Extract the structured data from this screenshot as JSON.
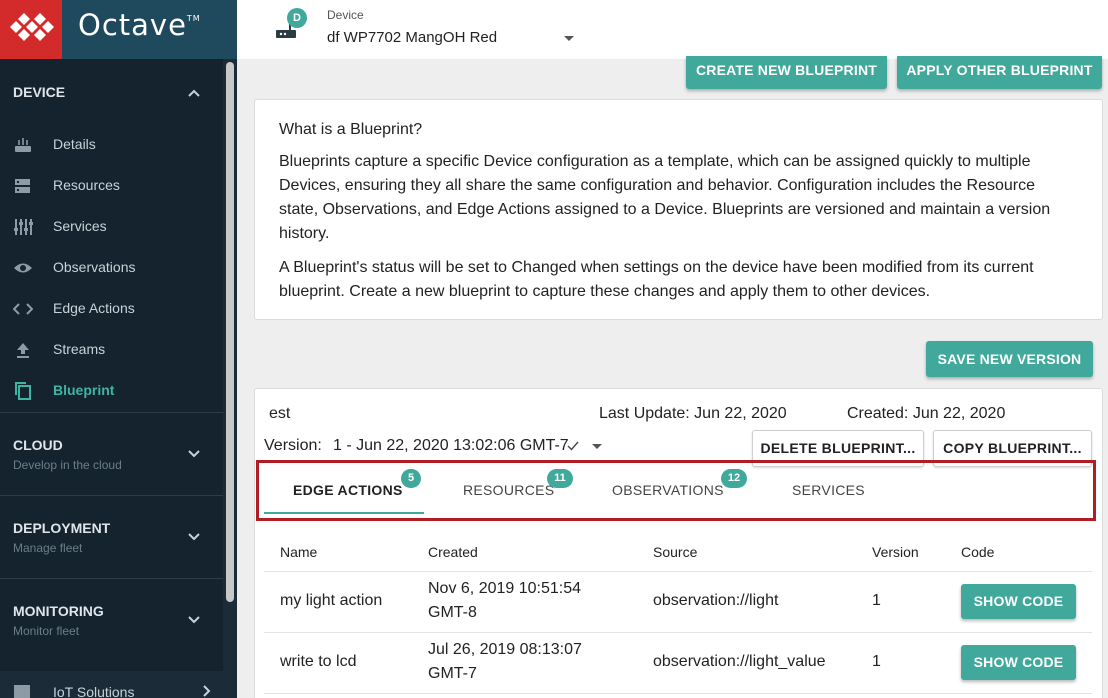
{
  "app": {
    "logo_text": "Octave",
    "logo_tm": "TM"
  },
  "sidebar": {
    "device_section": {
      "title": "DEVICE"
    },
    "items": [
      {
        "label": "Details",
        "icon": "router-icon"
      },
      {
        "label": "Resources",
        "icon": "storage-icon"
      },
      {
        "label": "Services",
        "icon": "tune-icon"
      },
      {
        "label": "Observations",
        "icon": "eye-icon"
      },
      {
        "label": "Edge Actions",
        "icon": "code-icon"
      },
      {
        "label": "Streams",
        "icon": "upload-icon"
      },
      {
        "label": "Blueprint",
        "icon": "copy-icon",
        "active": true
      }
    ],
    "cloud": {
      "title": "CLOUD",
      "subtitle": "Develop in the cloud"
    },
    "deployment": {
      "title": "DEPLOYMENT",
      "subtitle": "Manage fleet"
    },
    "monitoring": {
      "title": "MONITORING",
      "subtitle": "Monitor fleet"
    },
    "iot": {
      "label": "IoT Solutions"
    }
  },
  "header": {
    "device_label": "Device",
    "device_name": "df WP7702 MangOH Red",
    "avatar_letter": "D"
  },
  "actions": {
    "create": "CREATE NEW BLUEPRINT",
    "apply": "APPLY OTHER BLUEPRINT",
    "save_version": "SAVE NEW VERSION"
  },
  "info": {
    "title": "What is a Blueprint?",
    "p1": "Blueprints capture a specific Device configuration as a template, which can be assigned quickly to multiple Devices, ensuring they all share the same configuration and behavior. Configuration includes the Resource state, Observations, and Edge Actions assigned to a Device. Blueprints are versioned and maintain a version history.",
    "p2": "A Blueprint's status will be set to Changed when settings on the device have been modified from its current blueprint. Create a new blueprint to capture these changes and apply them to other devices."
  },
  "blueprint": {
    "name": "est",
    "last_update": "Last Update: Jun 22, 2020",
    "created": "Created: Jun 22, 2020",
    "version_label": "Version:",
    "version_value": "1 - Jun 22, 2020 13:02:06 GMT-7",
    "delete": "DELETE BLUEPRINT...",
    "copy": "COPY BLUEPRINT..."
  },
  "tabs": [
    {
      "label": "EDGE ACTIONS",
      "count": "5",
      "active": true
    },
    {
      "label": "RESOURCES",
      "count": "11"
    },
    {
      "label": "OBSERVATIONS",
      "count": "12"
    },
    {
      "label": "SERVICES",
      "count": ""
    }
  ],
  "table": {
    "headers": [
      "Name",
      "Created",
      "Source",
      "Version",
      "Code"
    ],
    "rows": [
      {
        "name": "my light action",
        "created_1": "Nov 6, 2019 10:51:54",
        "created_2": "GMT-8",
        "source": "observation://light",
        "version": "1",
        "code": "SHOW CODE"
      },
      {
        "name": "write to lcd",
        "created_1": "Jul 26, 2019 08:13:07",
        "created_2": "GMT-7",
        "source": "observation://light_value",
        "version": "1",
        "code": "SHOW CODE"
      }
    ]
  },
  "colors": {
    "accent": "#41a89c",
    "sidebar_bg": "#14232e",
    "logo_red": "#d32b2b",
    "highlight": "#b01e24"
  }
}
